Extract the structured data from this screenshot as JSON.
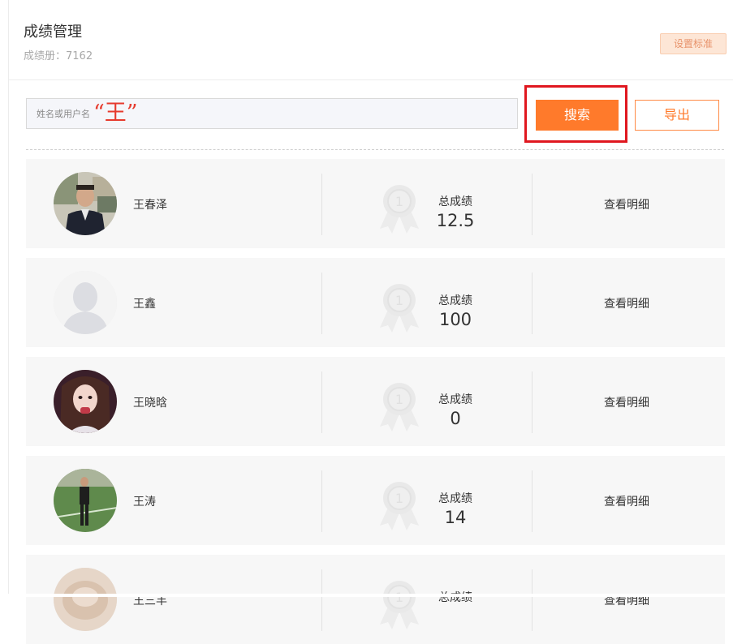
{
  "header": {
    "title": "成绩管理",
    "subtitle_label": "成绩册：",
    "subtitle_value": "7162",
    "settings_label": "设置标准"
  },
  "search": {
    "placeholder": "姓名或用户名",
    "value": "“王”",
    "search_label": "搜索",
    "export_label": "导出"
  },
  "list": {
    "score_label": "总成绩",
    "detail_label": "查看明细",
    "rows": [
      {
        "name": "王春泽",
        "score": "12.5",
        "avatar": "man-suit"
      },
      {
        "name": "王鑫",
        "score": "100",
        "avatar": "default-silhouette"
      },
      {
        "name": "王晓晗",
        "score": "0",
        "avatar": "girl-portrait"
      },
      {
        "name": "王涛",
        "score": "14",
        "avatar": "man-field"
      },
      {
        "name": "王三丰",
        "score": "",
        "avatar": "blurred"
      }
    ]
  },
  "icons": {
    "medal": "medal-icon"
  },
  "colors": {
    "accent": "#ff7a2b",
    "highlight": "#e0171f",
    "query_text": "#e63b2e"
  }
}
